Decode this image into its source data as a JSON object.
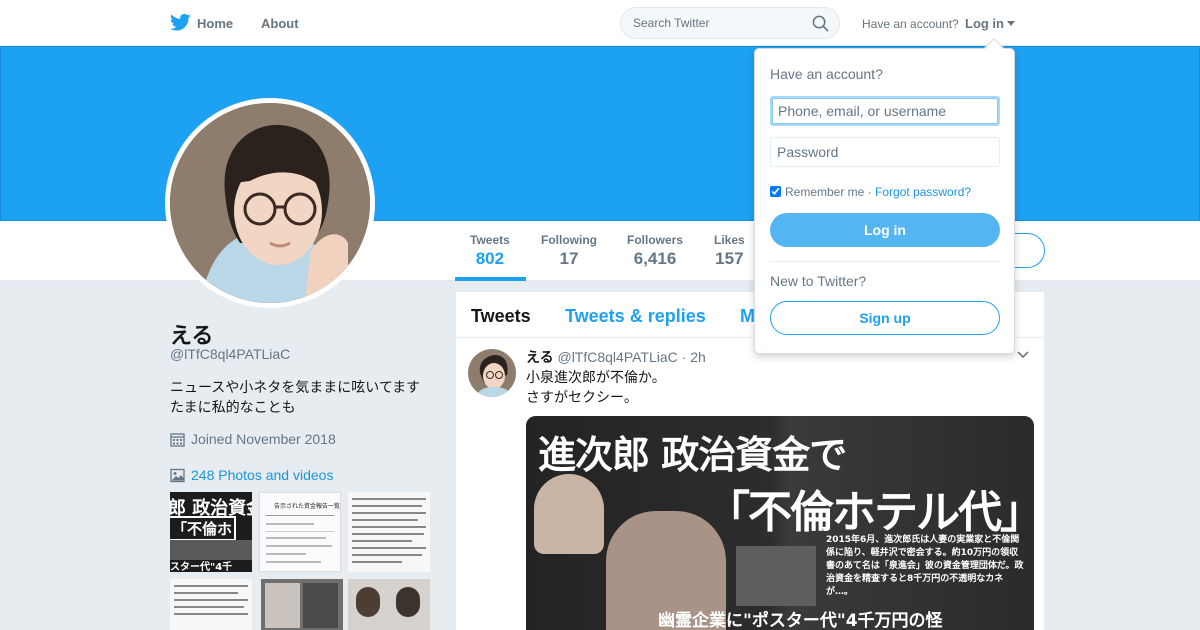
{
  "nav": {
    "home_label": "Home",
    "about_label": "About",
    "search_placeholder": "Search Twitter",
    "have_account": "Have an account?",
    "login_label": "Log in"
  },
  "profile": {
    "name": "える",
    "handle": "@lTfC8ql4PATLiaC",
    "bio_line1": "ニュースや小ネタを気ままに呟いてます",
    "bio_line2": "たまに私的なことも",
    "joined": "Joined November 2018",
    "photos_link": "248 Photos and videos"
  },
  "stats": [
    {
      "label": "Tweets",
      "value": "802"
    },
    {
      "label": "Following",
      "value": "17"
    },
    {
      "label": "Followers",
      "value": "6,416"
    },
    {
      "label": "Likes",
      "value": "157"
    }
  ],
  "tabs": [
    "Tweets",
    "Tweets & replies",
    "M"
  ],
  "tweet": {
    "name": "える",
    "handle": "@lTfC8ql4PATLiaC",
    "time": "2h",
    "line1": "小泉進次郎が不倫か。",
    "line2": "さすがセクシー。",
    "media_headline1": "進次郎 政治資金で",
    "media_headline2": "「不倫ホテル代」",
    "media_caption": "幽霊企業に\"ポスター代\"4千万円の怪",
    "media_body": "2015年6月、進次郎氏は人妻の実業家と不倫関係に陥り、軽井沢で密会する。約10万円の領収書のあて名は「泉進会」彼の資金管理団体だ。政治資金を精査すると8千万円の不透明なカネが…。"
  },
  "thumbs": {
    "t1_headline": "郎 政治資金",
    "t1_headline2": "「不倫ホ",
    "t1_caption": "スター代\"4千",
    "t2_title": "告示された資金報告一覧"
  },
  "login_dropdown": {
    "title": "Have an account?",
    "username_placeholder": "Phone, email, or username",
    "password_placeholder": "Password",
    "remember_label": "Remember me",
    "separator": " · ",
    "forgot_label": "Forgot password?",
    "login_button": "Log in",
    "new_label": "New to Twitter?",
    "signup_button": "Sign up"
  },
  "colors": {
    "brand": "#1da1f2",
    "link": "#1b95e0",
    "background": "#e6ecf0"
  }
}
